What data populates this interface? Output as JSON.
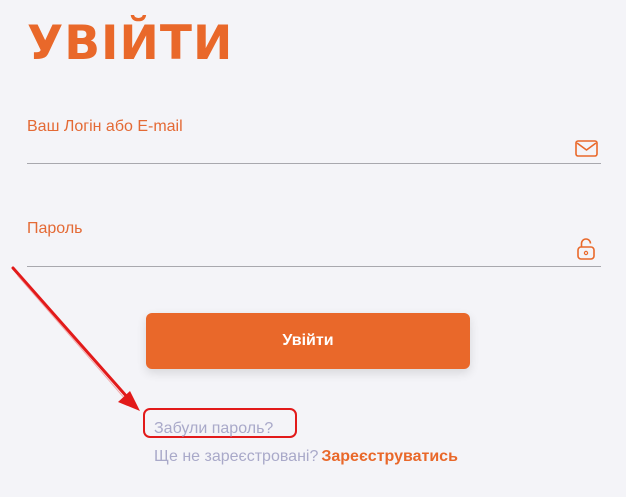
{
  "login": {
    "title": "УВІЙТИ",
    "login_field": {
      "label": "Ваш Логін або E-mail",
      "value": "",
      "icon": "envelope-icon"
    },
    "password_field": {
      "label": "Пароль",
      "value": "",
      "icon": "lock-icon"
    },
    "submit_label": "Увійти",
    "forgot_password_label": "Забули пароль?",
    "register_prompt": "Ще не зареєстровані?",
    "register_link_label": "Зареєструватись"
  },
  "annotation": {
    "arrow_color": "#e21a1a",
    "highlight_color": "#e21a1a"
  },
  "colors": {
    "accent": "#e9682a",
    "muted_link": "#a9a9c9",
    "background": "#f4f4f8"
  }
}
